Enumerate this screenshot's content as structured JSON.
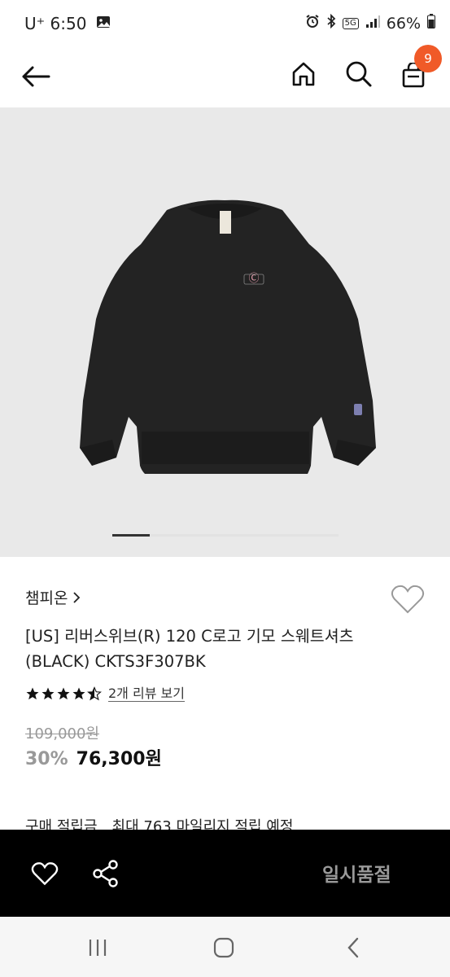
{
  "status_bar": {
    "carrier_time": "U⁺ 6:50",
    "battery": "66%",
    "network": "5G"
  },
  "header": {
    "cart_count": "9"
  },
  "product": {
    "brand": "챔피온",
    "title": "[US] 리버스위브(R) 120 C로고 기모 스웨트셔츠 (BLACK) CKTS3F307BK",
    "rating_stars": 4.5,
    "review_link": "2개 리뷰 보기",
    "original_price": "109,000원",
    "discount": "30%",
    "price": "76,300원",
    "points_label": "구매 적립금",
    "points_value": "최대 763 마일리지 적립 예정"
  },
  "bottom_bar": {
    "status_label": "일시품절"
  },
  "colors": {
    "badge": "#f05a28",
    "hero_bg": "#e9e9e9",
    "bottom_bar_bg": "#000000"
  }
}
